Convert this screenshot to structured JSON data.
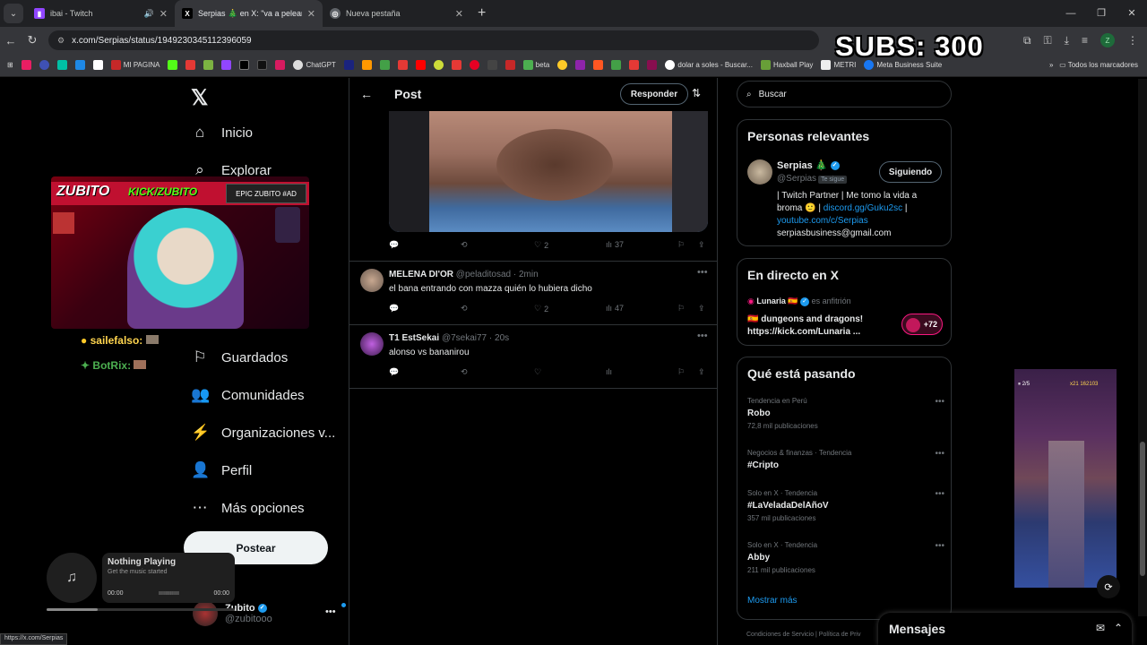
{
  "browser": {
    "tabs": [
      {
        "title": "ibai - Twitch",
        "favicon": "twitch-icon",
        "color": "#9146ff"
      },
      {
        "title": "Serpias 🎄 en X: \"va a pelear alon",
        "favicon": "x-icon",
        "color": "#000000"
      },
      {
        "title": "Nueva pestaña",
        "favicon": "chrome-icon",
        "color": "#5f6368"
      }
    ],
    "url": "x.com/Serpias/status/1949230345112396059",
    "bookmarks": [
      "MI PAGINA",
      "ChatGPT",
      "beta",
      "dolar a soles - Buscar...",
      "Haxball Play",
      "METRI",
      "Meta Business Suite"
    ],
    "all_bookmarks": "Todos los marcadores",
    "profile_initial": "Z",
    "status_url": "https://x.com/Serpias"
  },
  "overlay": {
    "subs": "SUBS: 300",
    "stream_name": "ZUBITO",
    "kick": "KICK/ZUBITO",
    "epic": "EPIC ZUBITO #AD",
    "chat": [
      {
        "user": "sailefalso:",
        "color": "#ffd54f"
      },
      {
        "user": "BotRix:",
        "color": "#4caf50"
      }
    ],
    "music_title": "Nothing Playing",
    "music_sub": "Get the music started",
    "music_start": "00:00",
    "music_end": "00:00",
    "music_progress": 0.27,
    "game_hud_left": "2/5",
    "game_hud_right": "x21 162103"
  },
  "nav": {
    "items": [
      {
        "label": "Inicio",
        "icon": "home-icon"
      },
      {
        "label": "Explorar",
        "icon": "search-icon"
      },
      {
        "label": "Guardados",
        "icon": "bookmark-icon"
      },
      {
        "label": "Comunidades",
        "icon": "communities-icon"
      },
      {
        "label": "Organizaciones v...",
        "icon": "lightning-icon"
      },
      {
        "label": "Perfil",
        "icon": "person-icon"
      },
      {
        "label": "Más opciones",
        "icon": "more-circle-icon"
      }
    ],
    "post_button": "Postear",
    "account_name": "Zubito",
    "account_handle": "@zubitooo"
  },
  "post": {
    "header": "Post",
    "reply_button": "Responder",
    "main_stats": {
      "likes": "2",
      "views": "37"
    },
    "replies": [
      {
        "name": "MELENA DI'OR",
        "handle": "@peladitosad",
        "time": "· 2min",
        "text": "el bana entrando con mazza quién lo hubiera dicho",
        "likes": "2",
        "views": "47",
        "avatar_color": "#6a5a50"
      },
      {
        "name": "T1 EstSekai",
        "handle": "@7sekai77",
        "time": "· 20s",
        "text": "alonso vs bananirou",
        "likes": "",
        "views": "",
        "avatar_color": "#3a1a4a"
      }
    ]
  },
  "sidebar": {
    "search_placeholder": "Buscar",
    "relevant_title": "Personas relevantes",
    "person": {
      "name": "Serpias 🎄",
      "handle": "@Serpias",
      "follows_you": "Te sigue",
      "follow_button": "Siguiendo",
      "bio_1": "| Twitch Partner | Me tomo la vida a broma 🙂 |",
      "bio_link_1": "discord.gg/Guku2sc",
      "bio_2": "|",
      "bio_link_2": "youtube.com/c/Serpias",
      "bio_email": "serpiasbusiness@gmail.com"
    },
    "live_title": "En directo en X",
    "live": {
      "host": "Lunaria 🇪🇸",
      "host_role": "es anfitrión",
      "title": "🇪🇸 dungeons and dragons! https://kick.com/Lunaria ...",
      "count": "+72"
    },
    "trends_title": "Qué está pasando",
    "trends": [
      {
        "context": "Tendencia en Perú",
        "topic": "Robo",
        "count": "72,8 mil publicaciones"
      },
      {
        "context": "Negocios & finanzas · Tendencia",
        "topic": "#Cripto",
        "count": ""
      },
      {
        "context": "Solo en X · Tendencia",
        "topic": "#LaVeladaDelAñoV",
        "count": "357 mil publicaciones"
      },
      {
        "context": "Solo en X · Tendencia",
        "topic": "Abby",
        "count": "211 mil publicaciones"
      }
    ],
    "show_more": "Mostrar más",
    "footer": "Condiciones de Servicio  |  Política de Priv"
  },
  "messages": {
    "title": "Mensajes"
  }
}
